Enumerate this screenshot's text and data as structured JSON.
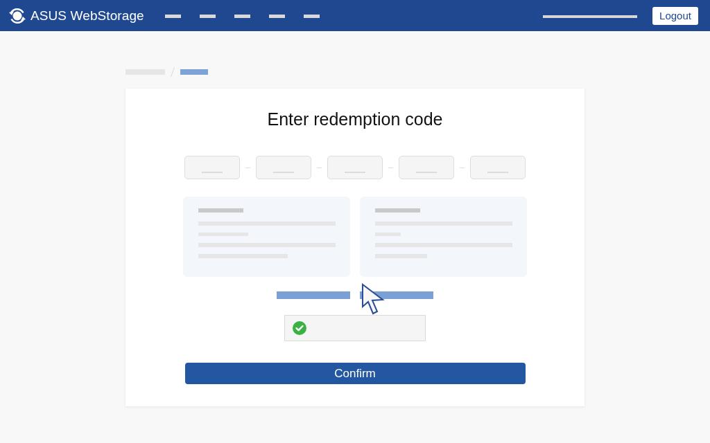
{
  "header": {
    "brand": "ASUS WebStorage",
    "logout_button": "Logout"
  },
  "redemption_card": {
    "title": "Enter redemption code",
    "verification": {
      "checked": true
    },
    "confirm_button": "Confirm"
  }
}
